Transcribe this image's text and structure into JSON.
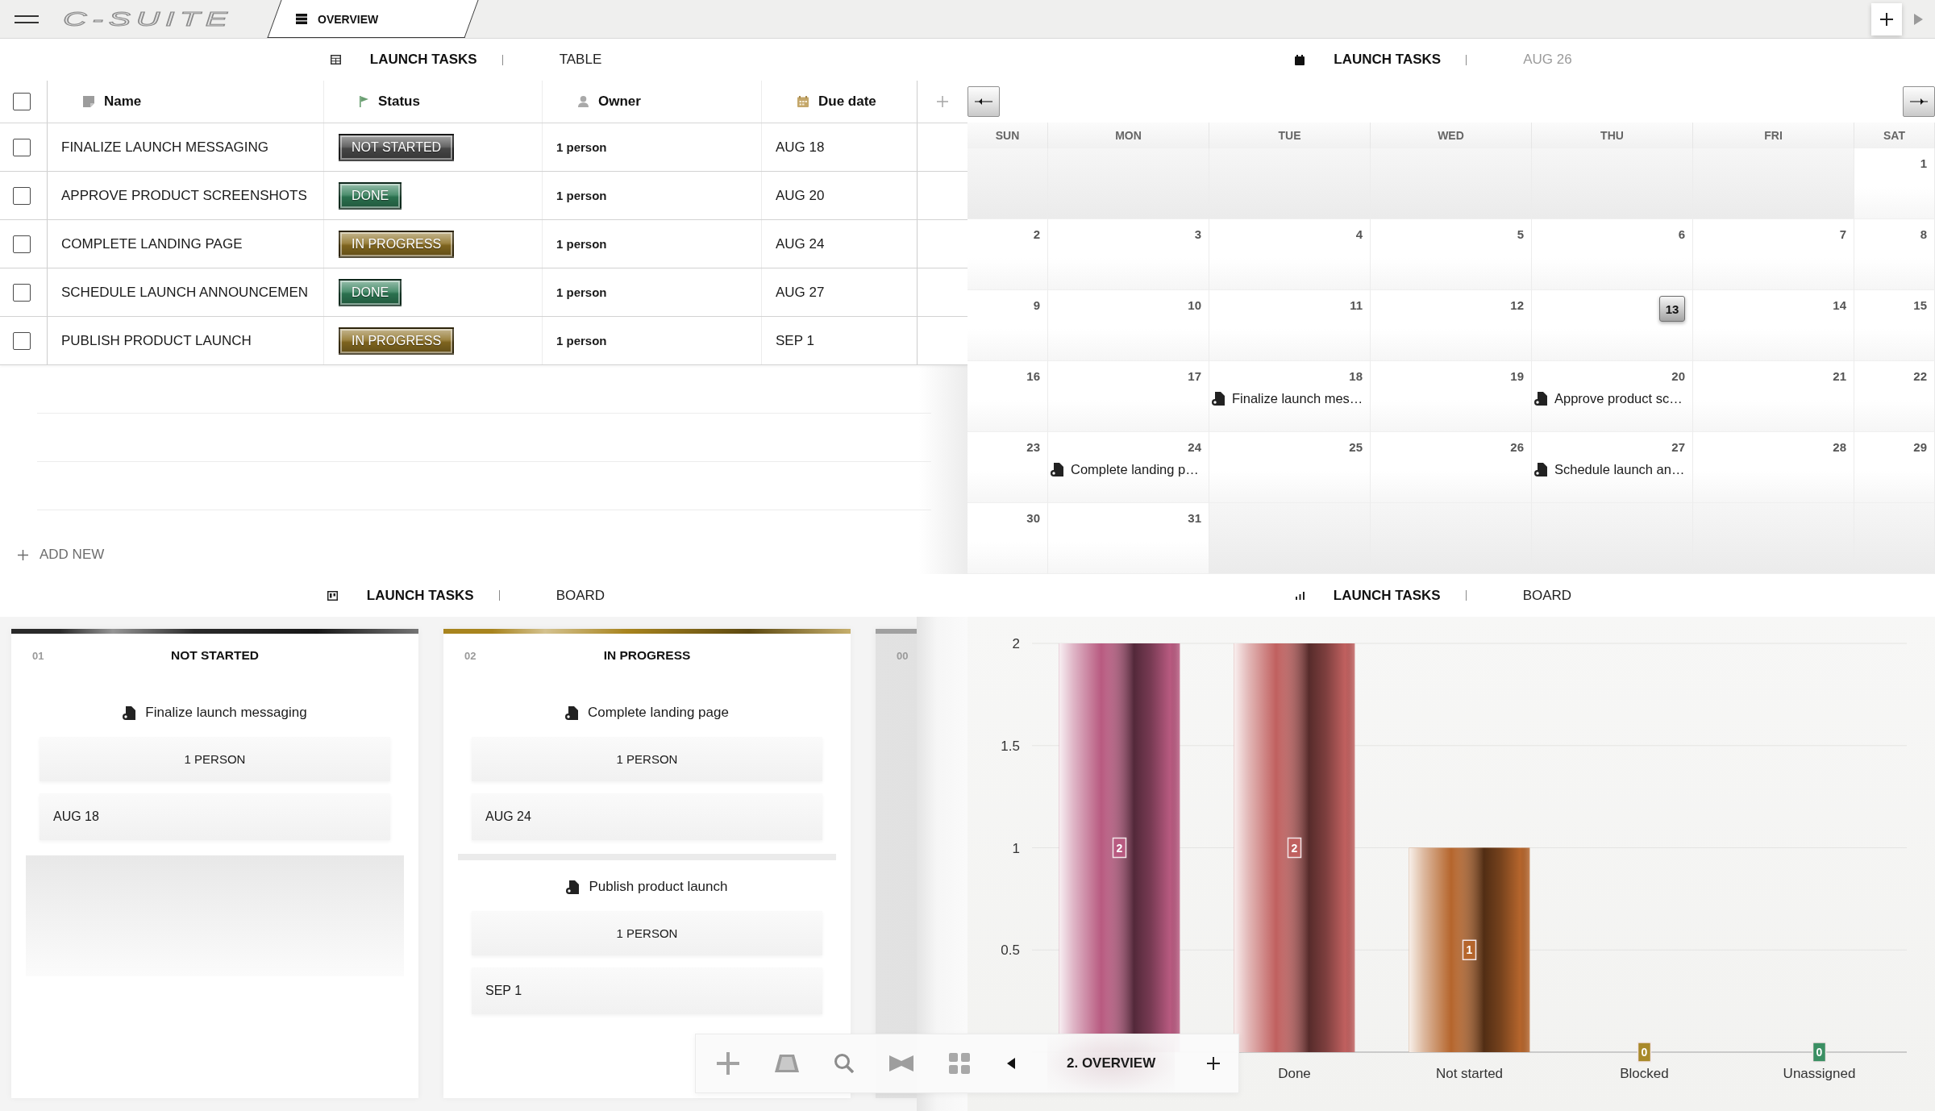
{
  "topbar": {
    "logo": "C-SUITE",
    "tabs": [
      {
        "label": "OVERVIEW",
        "selected": true
      }
    ]
  },
  "table_view": {
    "title": "LAUNCH TASKS",
    "view": "TABLE",
    "select_all": {
      "checked": false
    },
    "columns": [
      {
        "label": "Name",
        "kind": "text"
      },
      {
        "label": "Status",
        "kind": "status"
      },
      {
        "label": "Owner",
        "kind": "person"
      },
      {
        "label": "Due date",
        "kind": "date"
      }
    ],
    "rows": [
      {
        "checked": false,
        "name": "FINALIZE LAUNCH MESSAGING",
        "status": {
          "label": "NOT STARTED",
          "color": "#4d4d4d"
        },
        "owner": "1 person",
        "due": "AUG 18"
      },
      {
        "checked": false,
        "name": "APPROVE PRODUCT SCREENSHOTS",
        "status": {
          "label": "DONE",
          "color": "#2f7d57"
        },
        "owner": "1 person",
        "due": "AUG 20"
      },
      {
        "checked": false,
        "name": "COMPLETE LANDING PAGE",
        "status": {
          "label": "IN PROGRESS",
          "color": "#8c6f22"
        },
        "owner": "1 person",
        "due": "AUG 24"
      },
      {
        "checked": false,
        "name": "SCHEDULE LAUNCH ANNOUNCEMEN",
        "status": {
          "label": "DONE",
          "color": "#2f7d57"
        },
        "owner": "1 person",
        "due": "AUG 27"
      },
      {
        "checked": false,
        "name": "PUBLISH PRODUCT LAUNCH",
        "status": {
          "label": "IN PROGRESS",
          "color": "#8c6f22"
        },
        "owner": "1 person",
        "due": "SEP 1"
      }
    ],
    "add_new": "ADD NEW"
  },
  "calendar_view": {
    "title": "LAUNCH TASKS",
    "period": "AUG 26",
    "weekdays": [
      "SUN",
      "MON",
      "TUE",
      "WED",
      "THU",
      "FRI",
      "SAT"
    ],
    "weeks": [
      [
        {
          "kind": "blank"
        },
        {
          "kind": "blank"
        },
        {
          "kind": "blank"
        },
        {
          "kind": "blank"
        },
        {
          "kind": "blank"
        },
        {
          "kind": "blank"
        },
        {
          "kind": "day",
          "day": "1",
          "today": false
        }
      ],
      [
        {
          "kind": "day",
          "day": "2",
          "today": false
        },
        {
          "kind": "day",
          "day": "3",
          "today": false
        },
        {
          "kind": "day",
          "day": "4",
          "today": false
        },
        {
          "kind": "day",
          "day": "5",
          "today": false
        },
        {
          "kind": "day",
          "day": "6",
          "today": false
        },
        {
          "kind": "day",
          "day": "7",
          "today": false
        },
        {
          "kind": "day",
          "day": "8",
          "today": false
        }
      ],
      [
        {
          "kind": "day",
          "day": "9",
          "today": false
        },
        {
          "kind": "day",
          "day": "10",
          "today": false
        },
        {
          "kind": "day",
          "day": "11",
          "today": false
        },
        {
          "kind": "day",
          "day": "12",
          "today": false
        },
        {
          "kind": "day",
          "day": "13",
          "today": true
        },
        {
          "kind": "day",
          "day": "14",
          "today": false
        },
        {
          "kind": "day",
          "day": "15",
          "today": false
        }
      ],
      [
        {
          "kind": "day",
          "day": "16",
          "today": false
        },
        {
          "kind": "day",
          "day": "17",
          "today": false
        },
        {
          "kind": "day",
          "day": "18",
          "today": false,
          "events": [
            {
              "title": "Finalize launch mes…"
            }
          ]
        },
        {
          "kind": "day",
          "day": "19",
          "today": false
        },
        {
          "kind": "day",
          "day": "20",
          "today": false,
          "events": [
            {
              "title": "Approve product sc…"
            }
          ]
        },
        {
          "kind": "day",
          "day": "21",
          "today": false
        },
        {
          "kind": "day",
          "day": "22",
          "today": false
        }
      ],
      [
        {
          "kind": "day",
          "day": "23",
          "today": false
        },
        {
          "kind": "day",
          "day": "24",
          "today": false,
          "events": [
            {
              "title": "Complete landing p…"
            }
          ]
        },
        {
          "kind": "day",
          "day": "25",
          "today": false
        },
        {
          "kind": "day",
          "day": "26",
          "today": false
        },
        {
          "kind": "day",
          "day": "27",
          "today": false,
          "events": [
            {
              "title": "Schedule launch an…"
            }
          ]
        },
        {
          "kind": "day",
          "day": "28",
          "today": false
        },
        {
          "kind": "day",
          "day": "29",
          "today": false
        }
      ],
      [
        {
          "kind": "day",
          "day": "30",
          "today": false
        },
        {
          "kind": "day",
          "day": "31",
          "today": false
        },
        {
          "kind": "blank"
        },
        {
          "kind": "blank"
        },
        {
          "kind": "blank"
        },
        {
          "kind": "blank"
        },
        {
          "kind": "blank"
        }
      ]
    ]
  },
  "board_view": {
    "title": "LAUNCH TASKS",
    "view": "BOARD",
    "columns": [
      {
        "number": "01",
        "title": "NOT STARTED",
        "color": "#2a2a2a",
        "drop_zone": true,
        "cards": [
          {
            "title": "Finalize launch messaging",
            "owner": "1 PERSON",
            "due": "AUG 18"
          }
        ]
      },
      {
        "number": "02",
        "title": "IN PROGRESS",
        "color": "#a8841e",
        "drop_zone": false,
        "cards": [
          {
            "title": "Complete landing page",
            "owner": "1 PERSON",
            "due": "AUG 24"
          },
          {
            "title": "Publish product launch",
            "owner": "1 PERSON",
            "due": "SEP 1"
          }
        ]
      },
      {
        "number": "00",
        "color": "#a0a0a0",
        "drop_zone": false
      }
    ]
  },
  "chart_view": {
    "title": "LAUNCH TASKS",
    "view": "BOARD",
    "chart_data": {
      "type": "bar",
      "categories": [
        null,
        "Done",
        "Not started",
        "Blocked",
        "Unassigned"
      ],
      "values": [
        2,
        2,
        1,
        0,
        0
      ],
      "colors": [
        "#b85a80",
        "#c0605f",
        "#b5652c",
        "#a8892a",
        "#3b8f63"
      ],
      "ylim": [
        0,
        2
      ],
      "yticks": [
        0.5,
        1,
        1.5,
        2
      ],
      "grid": true,
      "data_labels": true
    }
  },
  "toolbar": {
    "page": "2. OVERVIEW"
  }
}
